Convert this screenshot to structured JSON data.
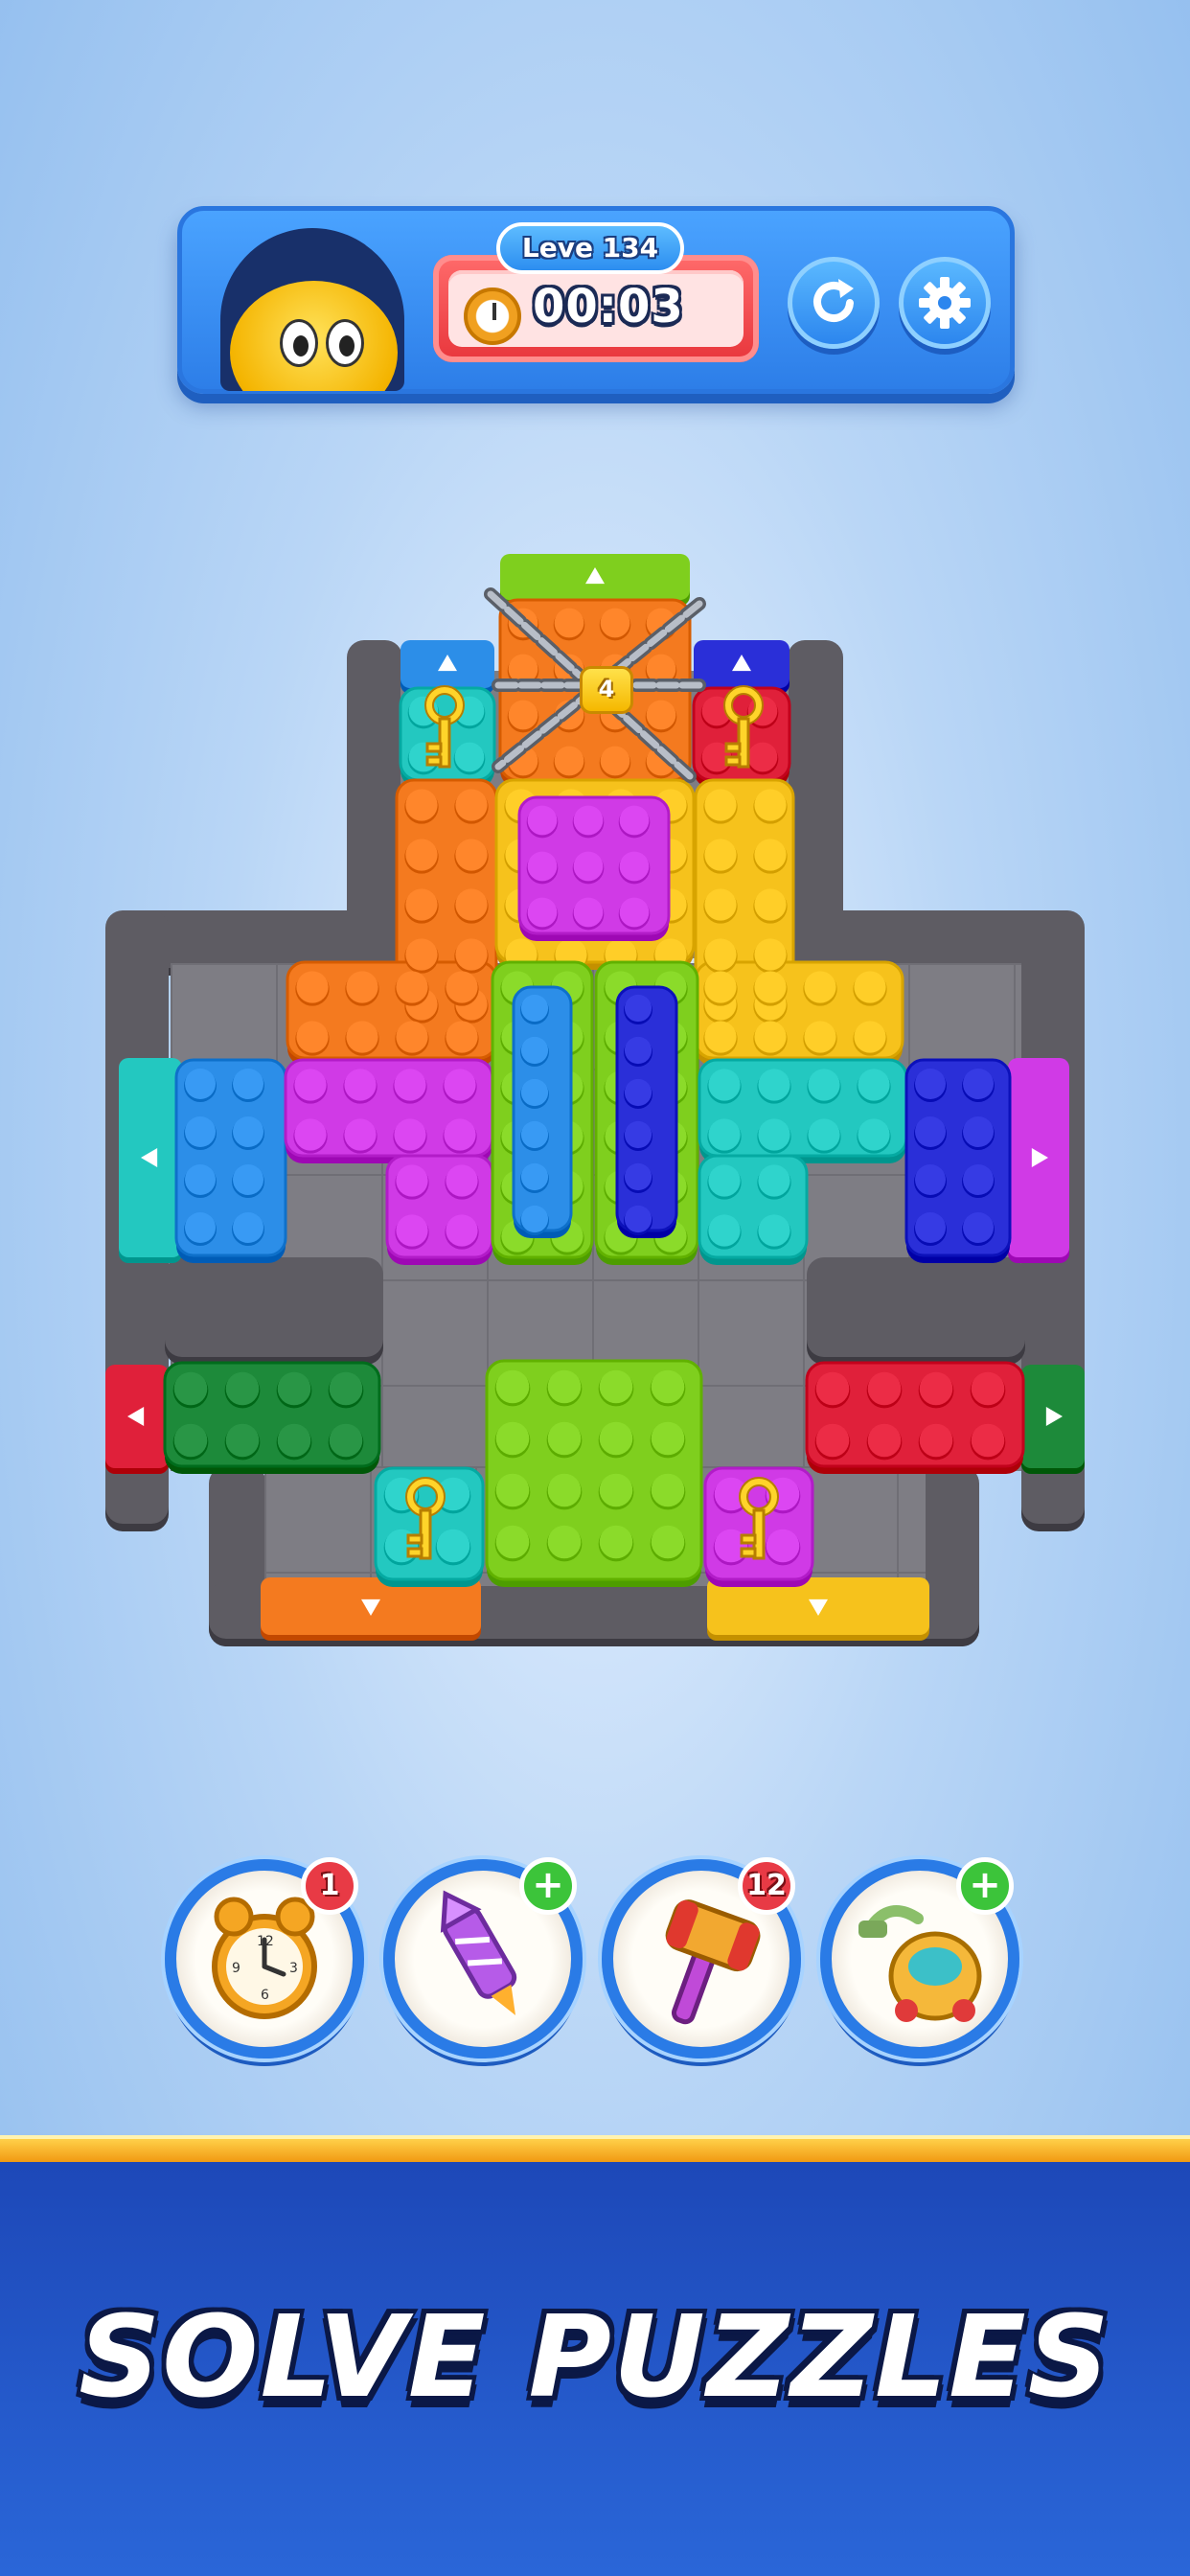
{
  "hud": {
    "level_label": "Leve 134",
    "timer": "00:03",
    "restart_icon": "restart-icon",
    "settings_icon": "gear-icon",
    "avatar": "yellow-character-avatar"
  },
  "board": {
    "lock_count": "4",
    "colors": {
      "orange": "#f47a1f",
      "yellow": "#f6c21c",
      "magenta": "#d03ae6",
      "cyan": "#23c8c0",
      "blue": "#2c8ee8",
      "navy": "#2a2fd8",
      "green": "#7fcf1e",
      "dark_green": "#1d8a3a",
      "red": "#e0203a",
      "wall": "#5e5c63"
    }
  },
  "boosters": [
    {
      "name": "alarm-clock-booster",
      "icon": "alarm-clock-icon",
      "badge": "1",
      "badge_type": "count"
    },
    {
      "name": "rocket-booster",
      "icon": "rocket-icon",
      "badge": "+",
      "badge_type": "add"
    },
    {
      "name": "hammer-booster",
      "icon": "hammer-icon",
      "badge": "12",
      "badge_type": "count"
    },
    {
      "name": "vacuum-booster",
      "icon": "vacuum-icon",
      "badge": "+",
      "badge_type": "add"
    }
  ],
  "banner": {
    "text": "SOLVE PUZZLES"
  }
}
